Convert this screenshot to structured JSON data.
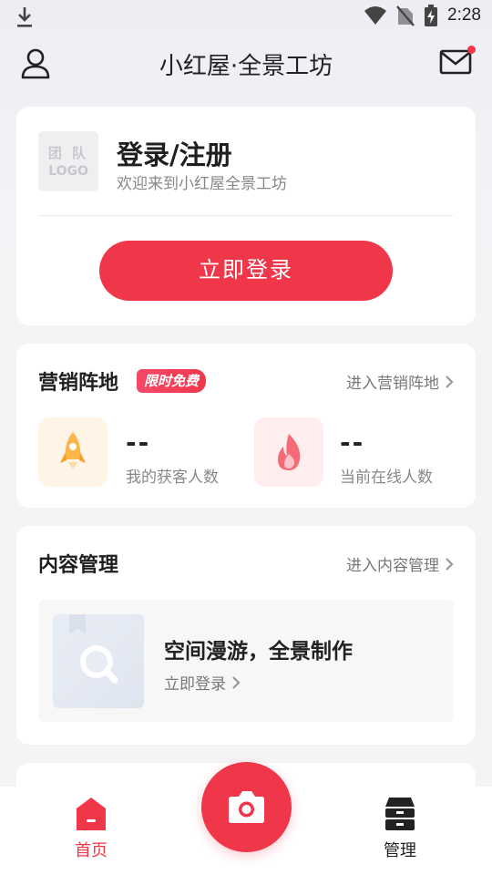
{
  "status_bar": {
    "time": "2:28"
  },
  "header": {
    "title": "小红屋·全景工坊"
  },
  "login": {
    "logo_line1": "团 队",
    "logo_line2": "LOGO",
    "title": "登录/注册",
    "subtitle": "欢迎来到小红屋全景工坊",
    "button": "立即登录"
  },
  "marketing": {
    "title": "营销阵地",
    "badge": "限时免费",
    "link": "进入营销阵地",
    "stats": [
      {
        "value": "--",
        "label": "我的获客人数",
        "icon": "rocket-icon"
      },
      {
        "value": "--",
        "label": "当前在线人数",
        "icon": "fire-icon"
      }
    ]
  },
  "content": {
    "title": "内容管理",
    "link": "进入内容管理",
    "promo_title": "空间漫游，全景制作",
    "promo_link": "立即登录"
  },
  "bottom_nav": {
    "home": "首页",
    "manage": "管理"
  },
  "colors": {
    "accent": "#f0374a",
    "background": "#f4f4f6"
  }
}
